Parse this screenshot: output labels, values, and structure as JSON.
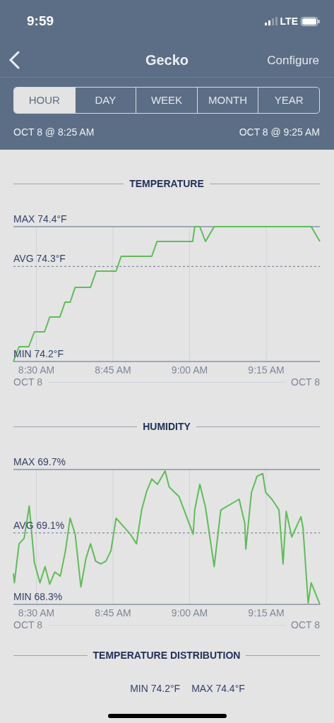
{
  "status_bar": {
    "time": "9:59",
    "network": "LTE"
  },
  "nav": {
    "title": "Gecko",
    "action": "Configure"
  },
  "range_tabs": [
    {
      "label": "HOUR",
      "selected": true
    },
    {
      "label": "DAY",
      "selected": false
    },
    {
      "label": "WEEK",
      "selected": false
    },
    {
      "label": "MONTH",
      "selected": false
    },
    {
      "label": "YEAR",
      "selected": false
    }
  ],
  "range": {
    "start": "OCT 8 @ 8:25 AM",
    "end": "OCT 8 @ 9:25 AM"
  },
  "charts": [
    {
      "title": "TEMPERATURE",
      "max_label": "MAX 74.4°F",
      "avg_label": "AVG 74.3°F",
      "min_label": "MIN 74.2°F",
      "time_labels": [
        "8:30 AM",
        "8:45 AM",
        "9:00 AM",
        "9:15 AM"
      ],
      "date_start": "OCT 8",
      "date_end": "OCT 8"
    },
    {
      "title": "HUMIDITY",
      "max_label": "MAX 69.7%",
      "avg_label": "AVG 69.1%",
      "min_label": "MIN 68.3%",
      "time_labels": [
        "8:30 AM",
        "8:45 AM",
        "9:00 AM",
        "9:15 AM"
      ],
      "date_start": "OCT 8",
      "date_end": "OCT 8"
    }
  ],
  "distribution": {
    "title": "TEMPERATURE DISTRIBUTION",
    "min": "MIN 74.2°F",
    "max": "MAX 74.4°F"
  }
}
